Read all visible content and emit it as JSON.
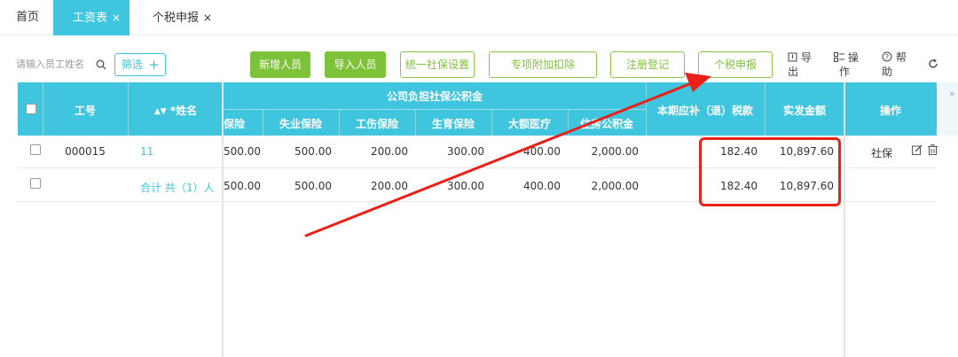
{
  "tabs": [
    {
      "label": "首页",
      "active": false
    },
    {
      "label": "工资表",
      "active": true,
      "closable": true
    },
    {
      "label": "个税申报",
      "active": false,
      "closable": true
    }
  ],
  "close_glyph": "×",
  "search": {
    "placeholder": "请输入员工姓名",
    "icon": "search-icon"
  },
  "filter": {
    "label": "筛选",
    "icon": "plus-icon"
  },
  "buttons": {
    "add_person": "新增人员",
    "import_person": "导入人员",
    "unified_social": "统一社保设置",
    "special_deduction": "专项附加扣除",
    "register": "注册登记",
    "tax_declare": "个税申报"
  },
  "tools": {
    "export": {
      "line1": "导",
      "line2": "出",
      "icon": "export-icon"
    },
    "operate": {
      "line1": "操",
      "line2": "作",
      "icon": "grid-icon"
    },
    "help": {
      "line1": "帮",
      "line2": "助",
      "icon": "help-icon"
    },
    "refresh_icon": "refresh-icon"
  },
  "table": {
    "headers": {
      "emp_no": "工号",
      "name": "*姓名",
      "company_group": "公司负担社保公积金",
      "pension": "保险",
      "unemployment": "失业保险",
      "injury": "工伤保险",
      "maternity": "生育保险",
      "medical": "大额医疗",
      "housing": "住房公积金",
      "tax": "本期应补（退）税款",
      "net_pay": "实发金额",
      "actions": "操作"
    },
    "rows": [
      {
        "emp_no": "000015",
        "name": "11",
        "pension": "500.00",
        "unemployment": "500.00",
        "injury": "200.00",
        "maternity": "300.00",
        "medical": "400.00",
        "housing": "2,000.00",
        "tax": "182.40",
        "net_pay": "10,897.60",
        "action_label": "社保"
      },
      {
        "emp_no": "",
        "name": "合计 共（1）人",
        "pension": "500.00",
        "unemployment": "500.00",
        "injury": "200.00",
        "maternity": "300.00",
        "medical": "400.00",
        "housing": "2,000.00",
        "tax": "182.40",
        "net_pay": "10,897.60",
        "action_label": ""
      }
    ]
  },
  "colors": {
    "accent": "#3fc5dd",
    "green": "#7ec23a",
    "annotation": "#e8221a"
  }
}
